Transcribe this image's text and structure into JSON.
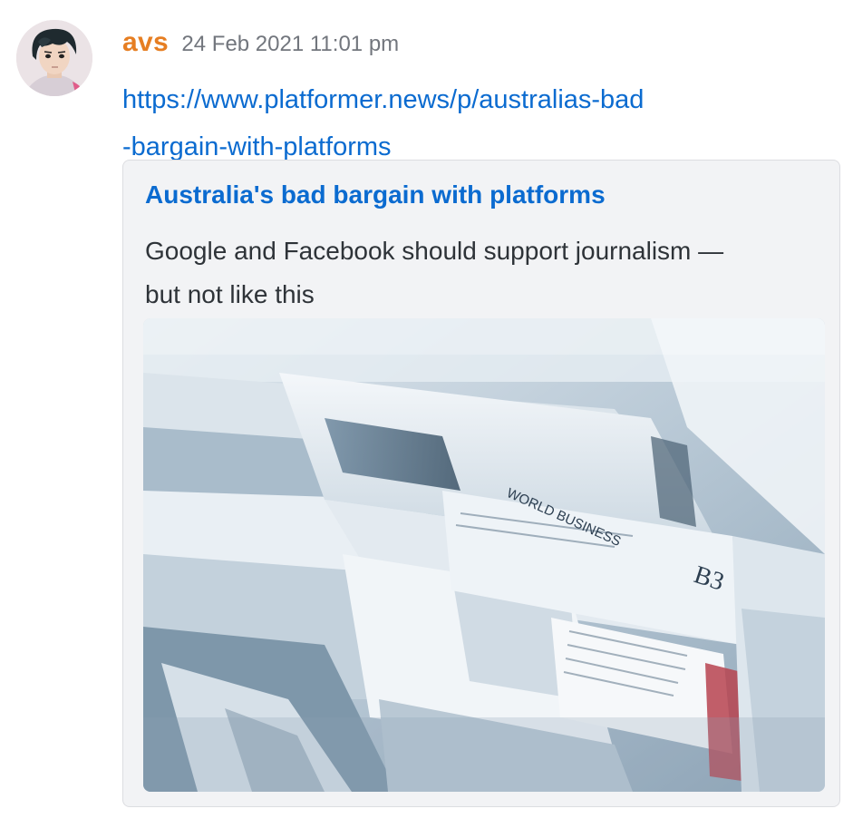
{
  "message": {
    "author": "avs",
    "timestamp": "24 Feb 2021 11:01 pm",
    "link_lines": [
      "https://www.platformer.news/p/australias-bad",
      "-bargain-with-platforms"
    ]
  },
  "embed": {
    "title": "Australia's bad bargain with platforms",
    "description_lines": [
      "Google and Facebook should support journalism —",
      "but not like this"
    ],
    "image": {
      "icon": "newspapers-photo",
      "visible_text": {
        "section": "WORLD BUSINESS",
        "page": "B3"
      }
    }
  },
  "colors": {
    "author": "#e67e22",
    "link": "#0b6bd0",
    "timestamp": "#72767d",
    "embed_bg": "#f2f3f5"
  }
}
